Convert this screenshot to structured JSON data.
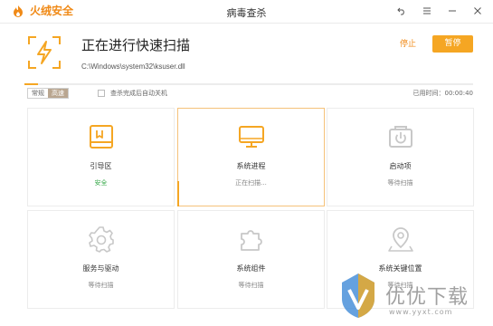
{
  "app": {
    "brand_name": "火绒安全",
    "window_title": "病毒查杀",
    "brand_color": "#f08a17"
  },
  "window_controls": {
    "icons": [
      "back-icon",
      "menu-icon",
      "minimize-icon",
      "close-icon"
    ]
  },
  "scan": {
    "title": "正在进行快速扫描",
    "current_path": "C:\\Windows\\system32\\ksuser.dll",
    "stop_label": "停止",
    "pause_label": "暂停",
    "accent_color": "#f5a623"
  },
  "mode": {
    "options": [
      "常规",
      "高速"
    ],
    "selected": "高速"
  },
  "auto_shutdown_label": "查杀完成后自动关机",
  "elapsed": "已用时间：00:00:40",
  "cards": [
    {
      "label": "引导区",
      "status": "安全",
      "icon": "boot-sector-icon"
    },
    {
      "label": "系统进程",
      "status": "正在扫描...",
      "icon": "monitor-icon"
    },
    {
      "label": "启动项",
      "status": "等待扫描",
      "icon": "startup-icon"
    },
    {
      "label": "服务与驱动",
      "status": "等待扫描",
      "icon": "gear-icon"
    },
    {
      "label": "系统组件",
      "status": "等待扫描",
      "icon": "puzzle-icon"
    },
    {
      "label": "系统关键位置",
      "status": "等待扫描",
      "icon": "location-icon"
    }
  ],
  "watermark": {
    "text": "优优下载",
    "url": "www.yyxt.com"
  }
}
